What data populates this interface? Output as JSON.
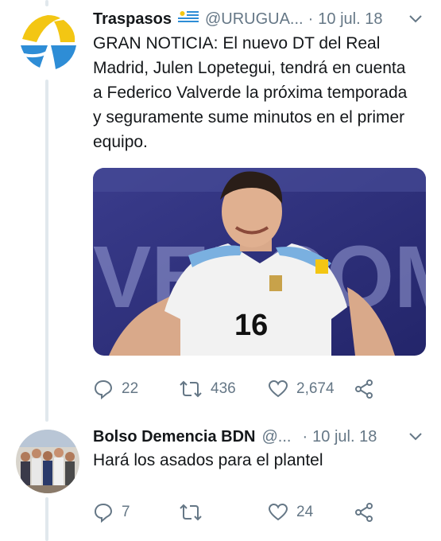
{
  "tweets": [
    {
      "name": "Traspasos",
      "flag": "uruguay-flag-emoji",
      "handle": "@URUGUA...",
      "separator": "·",
      "time": "10 jul. 18",
      "text": "GRAN NOTICIA: El nuevo DT del Real Madrid, Julen Lopetegui, tendrá en cuenta a Federico Valverde la próxima temporada y seguramente sume minutos en el primer equipo.",
      "media": {
        "background_text": "VELCOM",
        "jersey_number": "16"
      },
      "replies": "22",
      "retweets": "436",
      "likes": "2,674"
    },
    {
      "name": "Bolso Demencia BDN",
      "handle": "@...",
      "separator": "·",
      "time": "10 jul. 18",
      "text": "Hará los asados para el plantel",
      "replies": "7",
      "retweets": "",
      "likes": "24"
    }
  ],
  "colors": {
    "text": "#14171a",
    "secondary": "#657786",
    "thread_line": "#e1e8ed",
    "avatar_yellow": "#f3c613",
    "avatar_blue": "#2e8dd6"
  }
}
